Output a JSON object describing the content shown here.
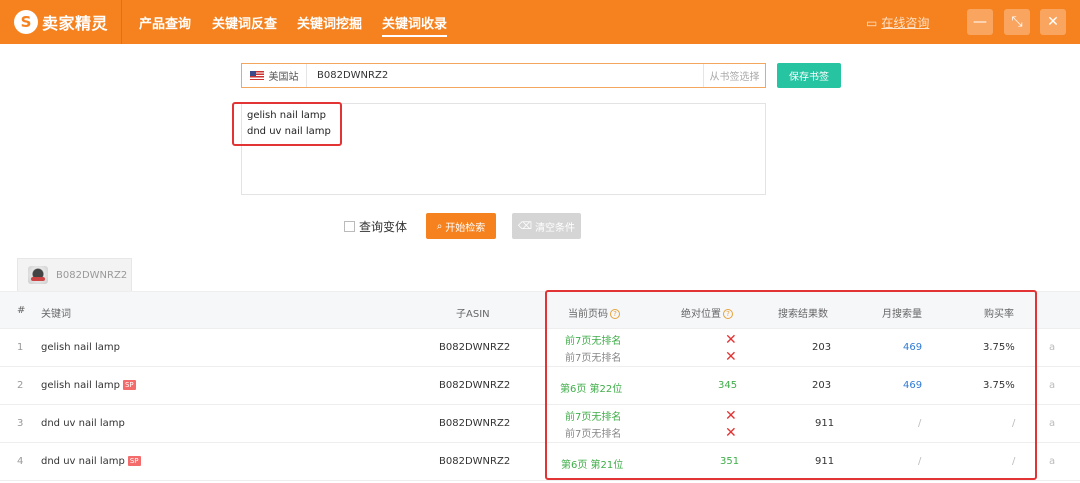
{
  "header": {
    "logo_text": "卖家精灵",
    "nav": [
      "产品查询",
      "关键词反查",
      "关键词挖掘",
      "关键词收录"
    ],
    "online": "在线咨询",
    "brand_color": "#f5821f"
  },
  "search": {
    "site": "美国站",
    "asin_value": "B082DWNRZ2",
    "from_bookmark": "从书签选择",
    "save_bookmark": "保存书签",
    "keywords": [
      "gelish nail lamp",
      "dnd uv nail lamp"
    ],
    "variant_label": "查询变体",
    "start_button": "开始检索",
    "clear_button": "清空条件"
  },
  "tab": {
    "asin": "B082DWNRZ2"
  },
  "table": {
    "headers": {
      "idx": "#",
      "keyword": "关键词",
      "child_asin": "子ASIN",
      "current_page": "当前页码",
      "abs_pos": "绝对位置",
      "results": "搜索结果数",
      "monthly": "月搜索量",
      "conversion": "购买率"
    },
    "sp_label": "SP",
    "rows": [
      {
        "idx": "1",
        "keyword": "gelish nail lamp",
        "sp": false,
        "asin": "B082DWNRZ2",
        "page1": "前7页无排名",
        "page2": "前7页无排名",
        "pos": "",
        "results": "203",
        "monthly": "469",
        "rate": "3.75%",
        "link": "a"
      },
      {
        "idx": "2",
        "keyword": "gelish nail lamp",
        "sp": true,
        "asin": "B082DWNRZ2",
        "page1": "第6页 第22位",
        "page2": "",
        "pos": "345",
        "results": "203",
        "monthly": "469",
        "rate": "3.75%",
        "link": "a"
      },
      {
        "idx": "3",
        "keyword": "dnd uv nail lamp",
        "sp": false,
        "asin": "B082DWNRZ2",
        "page1": "前7页无排名",
        "page2": "前7页无排名",
        "pos": "",
        "results": "911",
        "monthly": "/",
        "rate": "/",
        "link": "a"
      },
      {
        "idx": "4",
        "keyword": "dnd uv nail lamp",
        "sp": true,
        "asin": "B082DWNRZ2",
        "page1": "第6页 第21位",
        "page2": "",
        "pos": "351",
        "results": "911",
        "monthly": "/",
        "rate": "/",
        "link": "a"
      }
    ]
  },
  "colors": {
    "accent": "#f5821f",
    "save": "#27c4a2",
    "highlight_box": "#e23434",
    "green": "#3fae49",
    "blue": "#2e7bd6"
  }
}
